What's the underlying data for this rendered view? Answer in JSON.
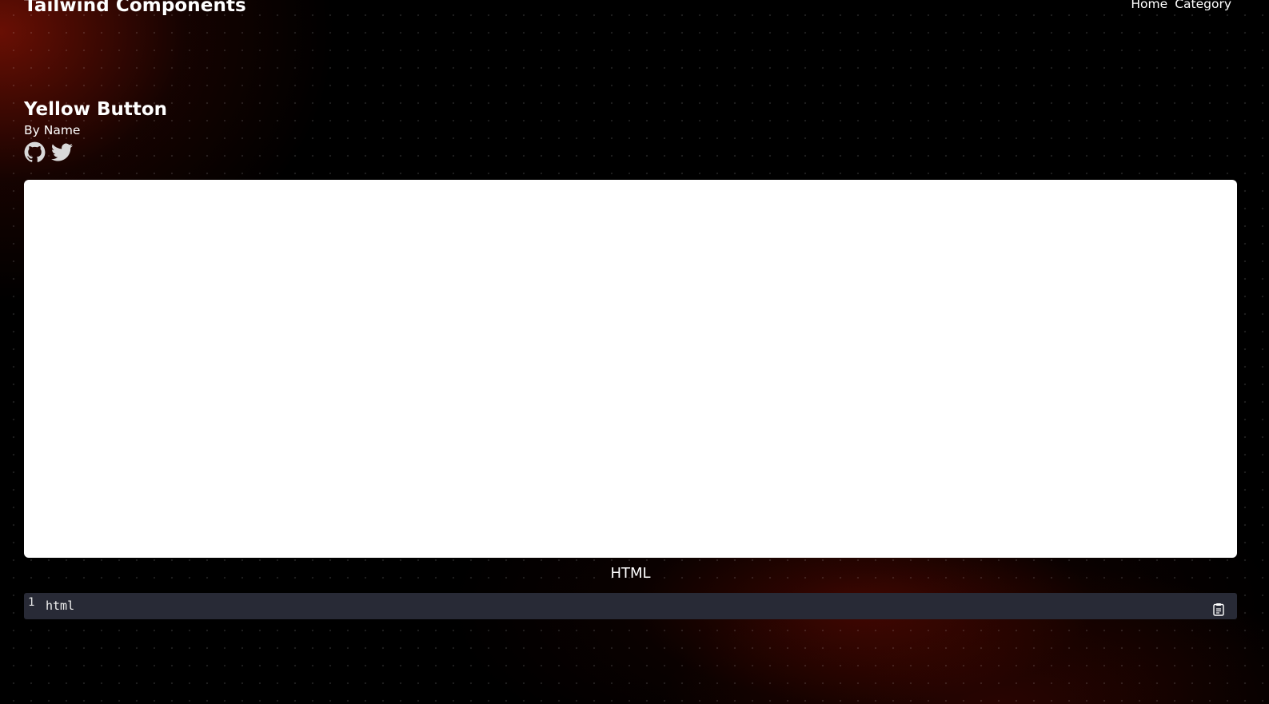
{
  "header": {
    "site_title": "Tailwind Components",
    "nav": [
      {
        "label": "Home"
      },
      {
        "label": "Category"
      }
    ]
  },
  "component": {
    "title": "Yellow Button",
    "author": "By Name",
    "socials": [
      {
        "icon": "github-icon"
      },
      {
        "icon": "twitter-icon"
      }
    ]
  },
  "code_section": {
    "label": "HTML",
    "lines": [
      {
        "number": "1",
        "text": "html"
      }
    ],
    "copy_icon": "clipboard-icon"
  },
  "colors": {
    "background": "#000000",
    "glow": "#8c1405",
    "preview_bg": "#ffffff",
    "code_bg": "#282a36",
    "icon": "#d9d9d9"
  }
}
